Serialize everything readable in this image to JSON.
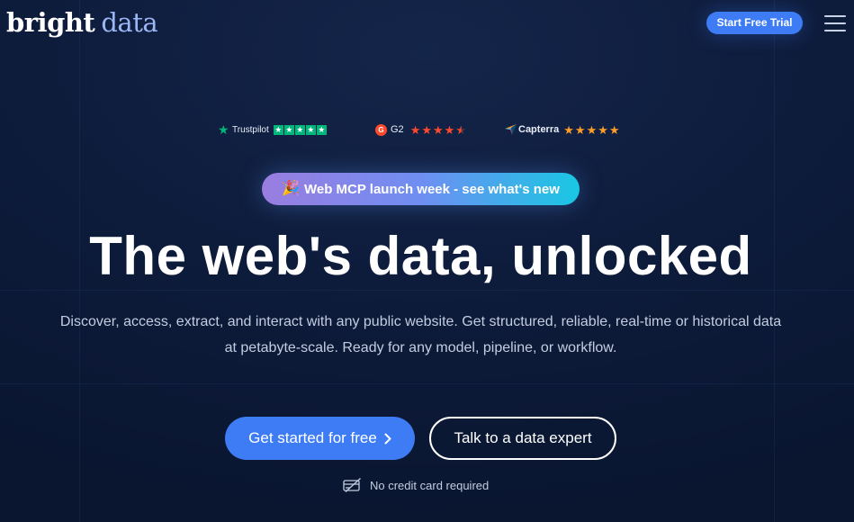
{
  "brand": {
    "logo_part1": "bright",
    "logo_part2": "data",
    "logo_color_primary": "#ffffff",
    "logo_color_accent": "#9cb7f5"
  },
  "header": {
    "cta_label": "Start Free Trial",
    "menu_icon": "hamburger-menu-icon"
  },
  "ratings": [
    {
      "name": "Trustpilot",
      "icon": "trustpilot-star-icon",
      "stars": 5,
      "star_color": "#00b67a"
    },
    {
      "name": "G2",
      "icon": "g2-logo-icon",
      "stars": 4.5,
      "star_color": "#ff492c"
    },
    {
      "name": "Capterra",
      "icon": "capterra-logo-icon",
      "stars": 5,
      "star_color": "#ff9d28"
    }
  ],
  "announcement": {
    "icon": "party-popper-icon",
    "label": "Web MCP launch week - see what's new"
  },
  "hero": {
    "title": "The web's data, unlocked",
    "description": "Discover, access, extract, and interact with any public website. Get structured, reliable, real-time or historical data at petabyte-scale. Ready for any model, pipeline, or workflow."
  },
  "cta": {
    "primary_label": "Get started for free",
    "primary_icon": "chevron-right-icon",
    "secondary_label": "Talk to a data expert",
    "note_icon": "credit-card-icon",
    "note": "No credit card required"
  },
  "colors": {
    "background": "#0d1b3a",
    "accent_blue": "#3d7cf5",
    "text_muted": "#c4cde0"
  }
}
